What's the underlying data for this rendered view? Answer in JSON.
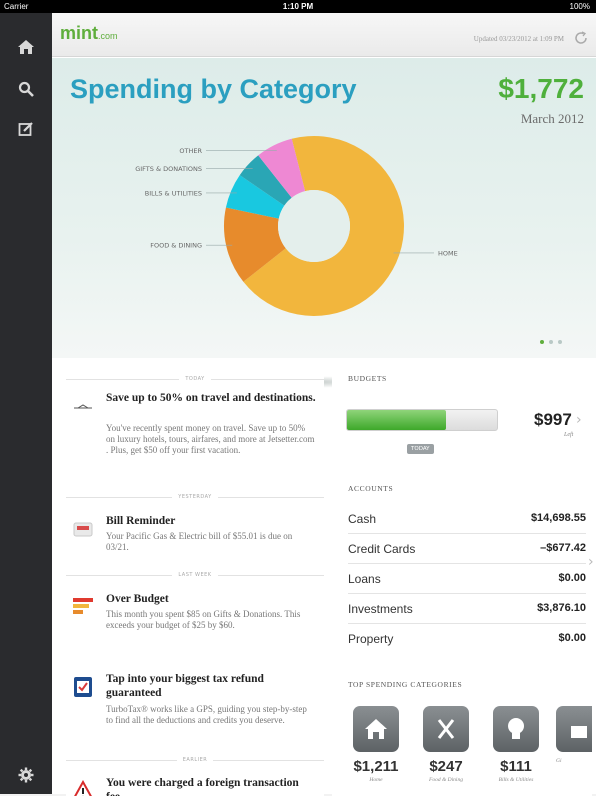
{
  "status_bar": {
    "carrier": "Carrier",
    "time": "1:10 PM",
    "battery": "100%"
  },
  "sidebar": {
    "icons": [
      "home-icon",
      "search-icon",
      "edit-icon",
      "settings-icon"
    ]
  },
  "header": {
    "logo": "mint",
    "logo_suffix": ".com",
    "updated": "Updated 03/23/2012 at 1:09 PM"
  },
  "hero": {
    "title": "Spending by Category",
    "total": "$1,772",
    "month": "March 2012",
    "page_indicator": {
      "count": 3,
      "active": 0
    }
  },
  "chart_data": {
    "type": "pie",
    "title": "Spending by Category",
    "categories": [
      "HOME",
      "FOOD & DINING",
      "BILLS & UTILITIES",
      "GIFTS & DONATIONS",
      "OTHER"
    ],
    "values": [
      1211,
      247,
      111,
      85,
      118
    ],
    "colors": [
      "#f2b63d",
      "#e78b2c",
      "#19c8e0",
      "#2aa6b5",
      "#ee88d3"
    ],
    "donut": true
  },
  "feed": {
    "separators": [
      "TODAY",
      "YESTERDAY",
      "LAST WEEK",
      "EARLIER"
    ],
    "items": [
      {
        "icon": "jetsetter-icon",
        "title": "Save up to 50% on travel and destinations.",
        "body": "You've recently spent money on travel. Save up to 50% on luxury hotels, tours, airfares, and more at Jetsetter.com . Plus, get $50 off your first vacation."
      },
      {
        "icon": "bill-icon",
        "title": "Bill Reminder",
        "body": "Your Pacific Gas & Electric bill of $55.01 is due on 03/21."
      },
      {
        "icon": "budget-icon",
        "title": "Over Budget",
        "body": "This month you spent $85 on Gifts & Donations. This exceeds your budget of $25 by $60."
      },
      {
        "icon": "turbotax-icon",
        "title": "Tap into your biggest tax refund guaranteed",
        "body": "TurboTax® works like a GPS, guiding you step-by-step to find all the deductions and credits you deserve."
      },
      {
        "icon": "warning-icon",
        "title": "You were charged a foreign transaction fee.",
        "body": ""
      }
    ]
  },
  "budgets": {
    "title": "BUDGETS",
    "progress": 0.66,
    "today_label": "TODAY",
    "amount": "$997",
    "amount_label": "Left"
  },
  "accounts": {
    "title": "ACCOUNTS",
    "rows": [
      {
        "name": "Cash",
        "value": "$14,698.55"
      },
      {
        "name": "Credit Cards",
        "value": "–$677.42"
      },
      {
        "name": "Loans",
        "value": "$0.00"
      },
      {
        "name": "Investments",
        "value": "$3,876.10"
      },
      {
        "name": "Property",
        "value": "$0.00"
      }
    ]
  },
  "top_spending": {
    "title": "TOP SPENDING CATEGORIES",
    "items": [
      {
        "icon": "home-icon",
        "amount": "$1,211",
        "name": "Home"
      },
      {
        "icon": "fork-knife-icon",
        "amount": "$247",
        "name": "Food & Dining"
      },
      {
        "icon": "lightbulb-icon",
        "amount": "$111",
        "name": "Bills & Utilities"
      },
      {
        "icon": "gift-icon",
        "amount": "",
        "name": "Gi"
      }
    ]
  }
}
